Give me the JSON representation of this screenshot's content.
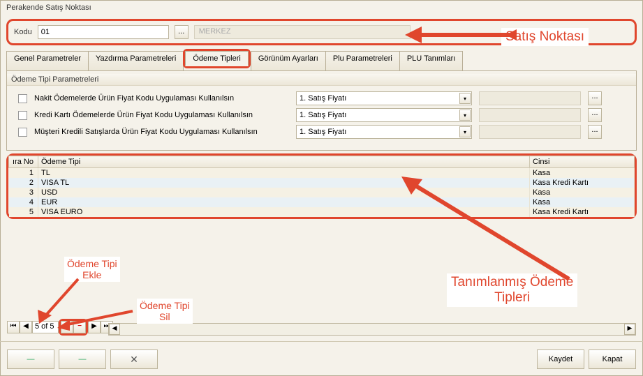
{
  "window": {
    "title": "Perakende Satış Noktası"
  },
  "top": {
    "code_label": "Kodu",
    "code_value": "01",
    "ellipsis": "...",
    "branch_placeholder": "MERKEZ"
  },
  "tabs": {
    "t1": "Genel Parametreler",
    "t2": "Yazdırma Parametreleri",
    "t3": "Ödeme Tipleri",
    "t4": "Görünüm Ayarları",
    "t5": "Plu Parametreleri",
    "t6": "PLU  Tanımları"
  },
  "group": {
    "title": "Ödeme Tipi Parametreleri"
  },
  "check": {
    "c1": "Nakit Ödemelerde Ürün Fiyat Kodu Uygulaması Kullanılsın",
    "c2": "Kredi Kartı Ödemelerde Ürün Fiyat Kodu Uygulaması Kullanılsın",
    "c3": "Müşteri Kredili Satışlarda Ürün Fiyat Kodu Uygulaması Kullanılsın",
    "combo": "1. Satış Fiyatı",
    "ellipsis": "..."
  },
  "grid": {
    "h1": "ıra No",
    "h2": "Ödeme Tipi",
    "h3": "Cinsi",
    "rows": [
      {
        "no": "1",
        "tip": "TL",
        "cins": "Kasa"
      },
      {
        "no": "2",
        "tip": "VISA TL",
        "cins": "Kasa Kredi Kartı"
      },
      {
        "no": "3",
        "tip": "USD",
        "cins": "Kasa"
      },
      {
        "no": "4",
        "tip": "EUR",
        "cins": "Kasa"
      },
      {
        "no": "5",
        "tip": "VISA EURO",
        "cins": "Kasa Kredi Kartı"
      }
    ]
  },
  "nav": {
    "first": "⏮",
    "prev": "◀",
    "counter": "5 of 5",
    "add": "+",
    "del": "−",
    "next": "▶",
    "last": "⏭"
  },
  "footer": {
    "b1": "—",
    "b2": "—",
    "b3": "✕",
    "save": "Kaydet",
    "close": "Kapat"
  },
  "anno": {
    "a1": "Satış Noktası",
    "a2": "Tanımlanmış Ödeme\nTipleri",
    "a3": "Ödeme Tipi\nEkle",
    "a4": "Ödeme Tipi\nSil"
  }
}
